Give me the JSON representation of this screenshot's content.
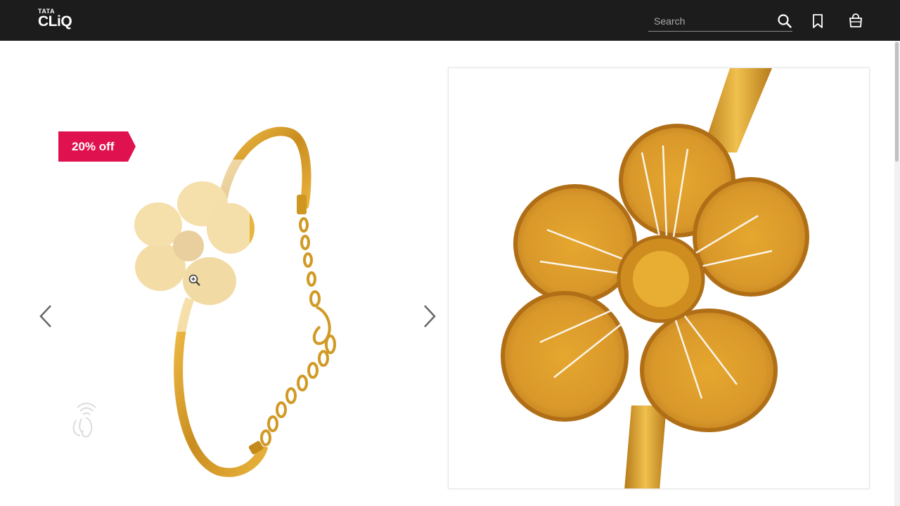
{
  "header": {
    "logo_top": "TATA",
    "logo_bottom": "CLiQ",
    "search_placeholder": "Search",
    "icons": [
      "search-icon",
      "bookmark-icon",
      "shopping-bag-icon"
    ]
  },
  "product": {
    "discount_badge": "20% off",
    "badge_color": "#e0114f",
    "gold_color": "#d9a234"
  },
  "gallery": {
    "prev_icon": "chevron-left-icon",
    "next_icon": "chevron-right-icon"
  }
}
